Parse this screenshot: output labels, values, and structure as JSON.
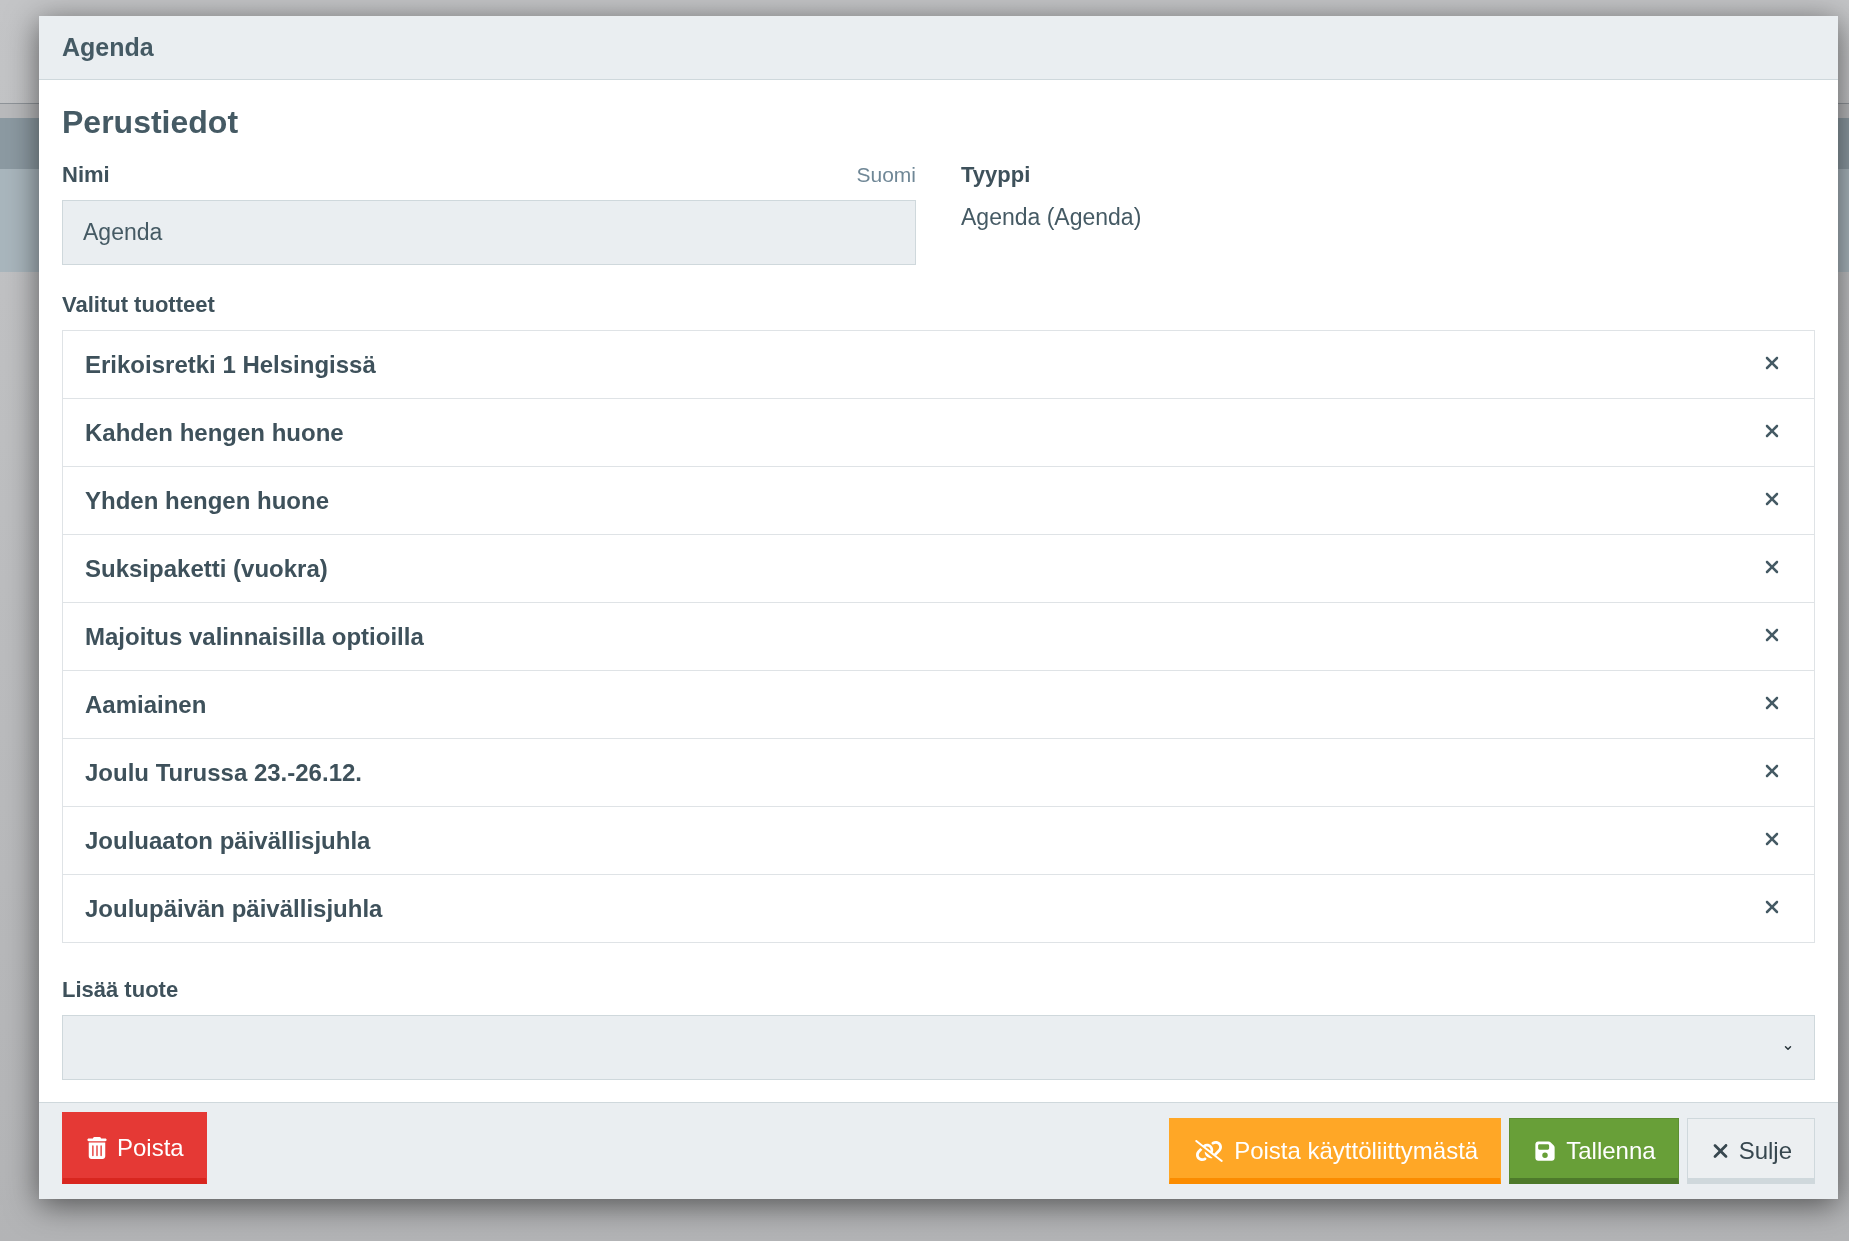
{
  "dialog": {
    "title": "Agenda"
  },
  "section_title": "Perustiedot",
  "name_field": {
    "label": "Nimi",
    "language": "Suomi",
    "value": "Agenda"
  },
  "type_field": {
    "label": "Tyyppi",
    "value": "Agenda (Agenda)"
  },
  "selected_products": {
    "label": "Valitut tuotteet",
    "items": [
      {
        "name": "Erikoisretki 1 Helsingissä"
      },
      {
        "name": "Kahden hengen huone"
      },
      {
        "name": "Yhden hengen huone"
      },
      {
        "name": "Suksipaketti (vuokra)"
      },
      {
        "name": "Majoitus valinnaisilla optioilla"
      },
      {
        "name": "Aamiainen"
      },
      {
        "name": "Joulu Turussa 23.-26.12."
      },
      {
        "name": "Jouluaaton päivällisjuhla"
      },
      {
        "name": "Joulupäivän päivällisjuhla"
      }
    ]
  },
  "add_product": {
    "label": "Lisää tuote"
  },
  "footer": {
    "left_buttons": [
      {
        "label": "Poista",
        "kind": "delete"
      }
    ],
    "right_buttons": [
      {
        "label": "Poista käyttöliittymästä",
        "kind": "unlink"
      },
      {
        "label": "Tallenna",
        "kind": "save"
      },
      {
        "label": "Sulje",
        "kind": "close"
      }
    ]
  }
}
